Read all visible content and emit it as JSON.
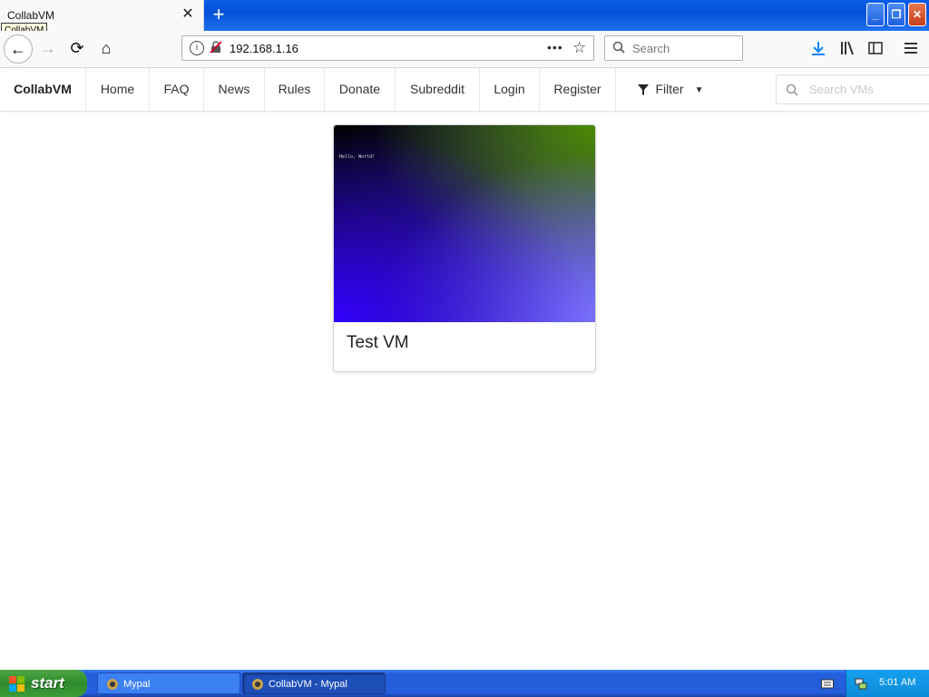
{
  "window": {
    "tab_title": "CollabVM",
    "tooltip": "CollabVM",
    "close_tab": "✕",
    "new_tab": "+",
    "minimize": "_",
    "maximize": "❐",
    "close": "✕"
  },
  "browser": {
    "back": "←",
    "forward": "→",
    "reload": "⟳",
    "home": "⌂",
    "url": "192.168.1.16",
    "url_more": "•••",
    "bookmark": "☆",
    "search_placeholder": "Search",
    "icons": [
      "download-icon",
      "library-icon",
      "sidebar-icon",
      "menu-icon"
    ]
  },
  "site_nav": {
    "brand": "CollabVM",
    "items": [
      "Home",
      "FAQ",
      "News",
      "Rules",
      "Donate",
      "Subreddit",
      "Login",
      "Register"
    ],
    "filter_label": "Filter",
    "search_placeholder": "Search VMs"
  },
  "vm_card": {
    "title": "Test VM",
    "thumbnail_text": "Hello, World!"
  },
  "taskbar": {
    "start_label": "start",
    "tasks": [
      "Mypal",
      "CollabVM - Mypal"
    ],
    "clock": "5:01 AM"
  },
  "colors": {
    "xp_blue": "#245edb",
    "start_green": "#3c9c37",
    "download_blue": "#0a84ff"
  }
}
